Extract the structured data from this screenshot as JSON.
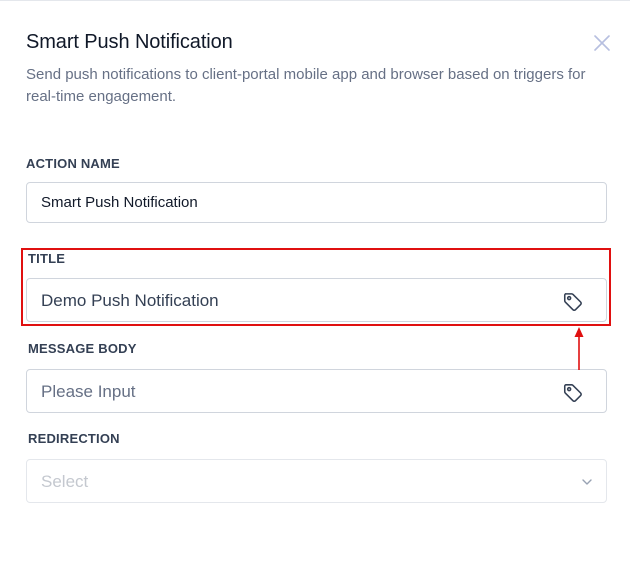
{
  "panel": {
    "title": "Smart Push Notification",
    "description": "Send push notifications to client-portal mobile app and browser based on triggers for real-time engagement.",
    "close_icon": "close-x-icon"
  },
  "action_name": {
    "label": "ACTION NAME",
    "value": "Smart Push Notification"
  },
  "title_field": {
    "label": "TITLE",
    "value": "Demo Push Notification",
    "icon": "tag-icon"
  },
  "message_body": {
    "label": "MESSAGE BODY",
    "placeholder": "Please Input",
    "icon": "tag-icon"
  },
  "redirection": {
    "label": "REDIRECTION",
    "placeholder": "Select",
    "icon": "chevron-down-icon"
  },
  "colors": {
    "annotation": "#e01010",
    "border": "#d0d5dd",
    "text": "#101828",
    "muted": "#667085"
  }
}
